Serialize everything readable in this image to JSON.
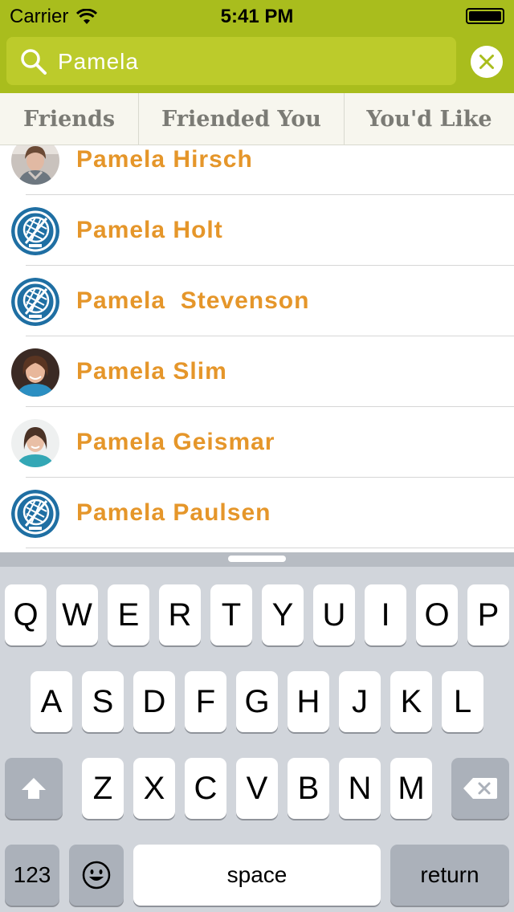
{
  "status_bar": {
    "carrier": "Carrier",
    "time": "5:41 PM"
  },
  "search": {
    "value": "Pamela",
    "icon": "search-icon",
    "clear_icon": "clear-icon"
  },
  "tabs": [
    {
      "label": "Friends"
    },
    {
      "label": "Friended You"
    },
    {
      "label": "You'd Like"
    }
  ],
  "people": [
    {
      "name": "Pamela Hirsch",
      "avatar": "photo"
    },
    {
      "name": "Pamela Holt",
      "avatar": "globe-default-avatar"
    },
    {
      "name": "Pamela  Stevenson",
      "avatar": "globe-default-avatar"
    },
    {
      "name": "Pamela Slim",
      "avatar": "photo"
    },
    {
      "name": "Pamela Geismar",
      "avatar": "photo"
    },
    {
      "name": "Pamela Paulsen",
      "avatar": "globe-default-avatar"
    }
  ],
  "keyboard": {
    "row1": [
      "Q",
      "W",
      "E",
      "R",
      "T",
      "Y",
      "U",
      "I",
      "O",
      "P"
    ],
    "row2": [
      "A",
      "S",
      "D",
      "F",
      "G",
      "H",
      "J",
      "K",
      "L"
    ],
    "row3": [
      "Z",
      "X",
      "C",
      "V",
      "B",
      "N",
      "M"
    ],
    "numbers_label": "123",
    "space_label": "space",
    "return_label": "return"
  },
  "colors": {
    "header": "#a9bd1d",
    "search_field": "#bccb2b",
    "name_text": "#e5962a",
    "tab_background": "#f7f6ee"
  }
}
